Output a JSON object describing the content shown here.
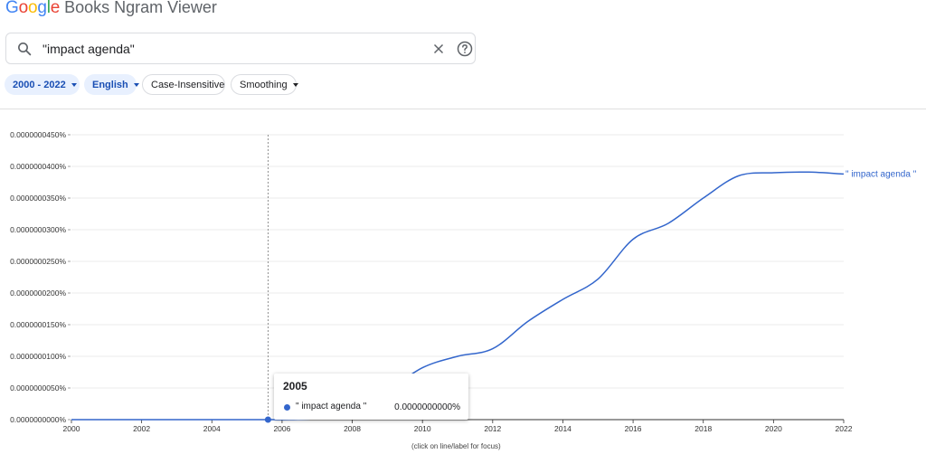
{
  "header": {
    "logo_letters": [
      {
        "ch": "G",
        "color": "#4285f4"
      },
      {
        "ch": "o",
        "color": "#ea4335"
      },
      {
        "ch": "o",
        "color": "#fbbc05"
      },
      {
        "ch": "g",
        "color": "#4285f4"
      },
      {
        "ch": "l",
        "color": "#34a853"
      },
      {
        "ch": "e",
        "color": "#ea4335"
      }
    ],
    "app_name": "Books Ngram Viewer"
  },
  "search": {
    "query": "\"impact agenda\"",
    "icons": [
      "search-icon",
      "close-icon",
      "help-icon"
    ]
  },
  "filters": {
    "year_range": "2000 - 2022",
    "corpus": "English",
    "case": "Case-Insensitive",
    "smoothing": "Smoothing"
  },
  "chart_data": {
    "type": "line",
    "y_tick_labels": [
      "0.0000000000%",
      "0.0000000050%",
      "0.0000000100%",
      "0.0000000150%",
      "0.0000000200%",
      "0.0000000250%",
      "0.0000000300%",
      "0.0000000350%",
      "0.0000000400%",
      "0.0000000450%"
    ],
    "ylim": [
      0,
      4.5e-08
    ],
    "xlim": [
      2000,
      2022
    ],
    "x_ticks": [
      2000,
      2002,
      2004,
      2006,
      2008,
      2010,
      2012,
      2014,
      2016,
      2018,
      2020,
      2022
    ],
    "grid": true,
    "series": [
      {
        "name": "\" impact agenda \"",
        "color": "#3366cc",
        "x": [
          2000,
          2001,
          2002,
          2003,
          2004,
          2005,
          2006,
          2007,
          2008,
          2009,
          2010,
          2011,
          2012,
          2013,
          2014,
          2015,
          2016,
          2017,
          2018,
          2019,
          2020,
          2021,
          2022
        ],
        "y": [
          0,
          0,
          0,
          0,
          0,
          0,
          0,
          2e-10,
          1.2e-09,
          4.5e-09,
          8.2e-09,
          1e-08,
          1.12e-08,
          1.55e-08,
          1.9e-08,
          2.22e-08,
          2.85e-08,
          3.1e-08,
          3.5e-08,
          3.85e-08,
          3.9e-08,
          3.91e-08,
          3.88e-08
        ]
      }
    ],
    "focus_year": 2005.6
  },
  "tooltip": {
    "year": "2005",
    "series_name": "\" impact agenda \"",
    "value": "0.0000000000%",
    "color": "#3366cc"
  },
  "footnote": "(click on line/label for focus)"
}
